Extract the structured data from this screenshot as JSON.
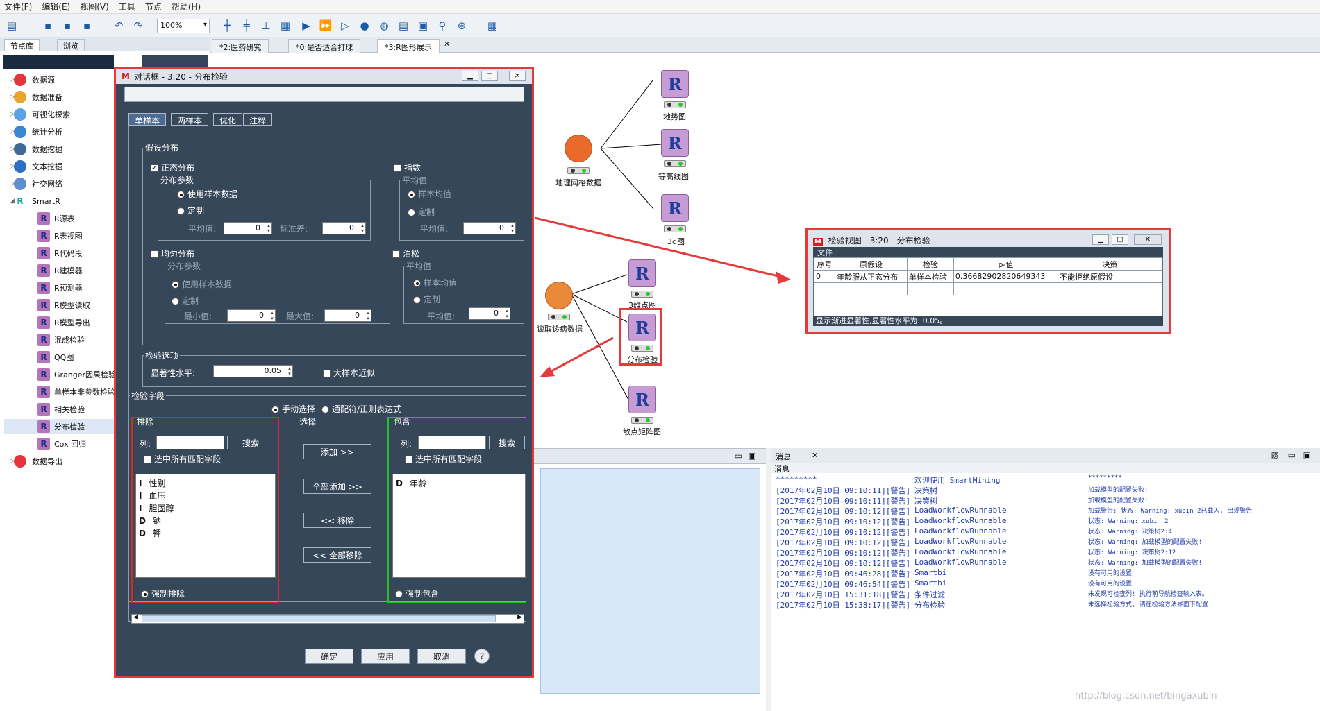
{
  "menu": [
    "文件(F)",
    "编辑(E)",
    "视图(V)",
    "工具",
    "节点",
    "帮助(H)"
  ],
  "toolbar": {
    "zoom": "100%"
  },
  "palette": {
    "tabs": [
      "节点库",
      "浏览"
    ],
    "categories": [
      "数据源",
      "数据准备",
      "可视化探索",
      "统计分析",
      "数据挖掘",
      "文本挖掘",
      "社交网络",
      "SmartR"
    ],
    "smartr_items": [
      "R源表",
      "R表视图",
      "R代码段",
      "R建模器",
      "R预测器",
      "R模型读取",
      "R模型导出",
      "混成检验",
      "QQ图",
      "Granger因果检验",
      "单样本非参数检验",
      "相关检验",
      "分布检验",
      "Cox 回归"
    ],
    "last": "数据导出"
  },
  "editor_tabs": [
    "*2:医药研究",
    "*0:是否适合打球",
    "*3:R图形展示"
  ],
  "workflow": {
    "nodes": [
      {
        "label": "地势图"
      },
      {
        "label": "等高线图"
      },
      {
        "label": "3d图"
      },
      {
        "label": "地理网格数据"
      },
      {
        "label": "3维点图"
      },
      {
        "label": "读取诊病数据"
      },
      {
        "label": "分布检验"
      },
      {
        "label": "散点矩阵图"
      }
    ],
    "r_letter": "R"
  },
  "dialog": {
    "title": "对话框 - 3:20 - 分布检验",
    "tabs": [
      "单样本",
      "两样本",
      "优化",
      "注释"
    ],
    "hypothesis_group": "假设分布",
    "normal": "正态分布",
    "exponential": "指数",
    "uniform": "均匀分布",
    "poisson": "泊松",
    "dist_params": "分布参数",
    "mean_val": "平均值",
    "use_sample": "使用样本数据",
    "custom": "定制",
    "sample_mean": "样本均值",
    "mean_label": "平均值:",
    "sd_label": "标准差:",
    "min_label": "最小值:",
    "max_label": "最大值:",
    "zero": "0",
    "test_options": "检验选项",
    "sig_label": "显著性水平:",
    "sig_value": "0.05",
    "large_sample": "大样本近似",
    "test_fields": "检验字段",
    "manual": "手动选择",
    "wildcard": "通配符/正则表达式",
    "exclude": "排除",
    "select": "选择",
    "include": "包含",
    "col_label": "列:",
    "search": "搜索",
    "select_all_match": "选中所有匹配字段",
    "excluded_fields": [
      {
        "type": "I",
        "name": "性别"
      },
      {
        "type": "I",
        "name": "血压"
      },
      {
        "type": "I",
        "name": "胆固醇"
      },
      {
        "type": "D",
        "name": "钠"
      },
      {
        "type": "D",
        "name": "钾"
      }
    ],
    "included_fields": [
      {
        "type": "D",
        "name": "年龄"
      }
    ],
    "add": "添加 >>",
    "add_all": "全部添加 >>",
    "remove": "<< 移除",
    "remove_all": "<< 全部移除",
    "force_exclude": "强制排除",
    "force_include": "强制包含",
    "ok": "确定",
    "apply": "应用",
    "cancel": "取消",
    "help": "?"
  },
  "result": {
    "title": "检验视图 - 3:20 - 分布检验",
    "menu": "文件",
    "headers": [
      "序号",
      "原假设",
      "检验",
      "p-值",
      "决策"
    ],
    "rows": [
      [
        "0",
        "年龄服从正态分布",
        "单样本检验",
        "0.36682902820649343",
        "不能拒绝原假设"
      ]
    ],
    "status": "显示渐进显著性,显著性水平为: 0.05。"
  },
  "messages": {
    "tab": "消息",
    "head": "消息",
    "rows": [
      [
        "*********",
        "欢迎使用 SmartMining",
        "*********"
      ],
      [
        "[2017年02月10日 09:10:11][警告]",
        "决策树",
        "加载模型的配置失败!"
      ],
      [
        "[2017年02月10日 09:10:11][警告]",
        "决策树",
        "加载模型的配置失败!"
      ],
      [
        "[2017年02月10日 09:10:12][警告]",
        "LoadWorkflowRunnable",
        "加载警告: 状态: Warning: xubin 2已载入, 出现警告"
      ],
      [
        "[2017年02月10日 09:10:12][警告]",
        "LoadWorkflowRunnable",
        "状态: Warning: xubin 2"
      ],
      [
        "[2017年02月10日 09:10:12][警告]",
        "LoadWorkflowRunnable",
        "状态: Warning: 决策树2:4"
      ],
      [
        "[2017年02月10日 09:10:12][警告]",
        "LoadWorkflowRunnable",
        "状态: Warning: 加载模型的配置失败!"
      ],
      [
        "[2017年02月10日 09:10:12][警告]",
        "LoadWorkflowRunnable",
        "状态: Warning: 决策树2:12"
      ],
      [
        "[2017年02月10日 09:10:12][警告]",
        "LoadWorkflowRunnable",
        "状态: Warning: 加载模型的配置失败!"
      ],
      [
        "[2017年02月10日 09:46:28][警告]",
        "Smartbi",
        "没有可用的设置"
      ],
      [
        "[2017年02月10日 09:46:54][警告]",
        "Smartbi",
        "没有可用的设置"
      ],
      [
        "[2017年02月10日 15:31:18][警告]",
        "条件过滤",
        "未发现可检查列! 执行前导航检查输入表。"
      ],
      [
        "[2017年02月10日 15:38:17][警告]",
        "分布检验",
        "未选择检验方式, 请在检验方法界面下配置"
      ]
    ]
  },
  "watermark": "http://blog.csdn.net/bingaxubin"
}
